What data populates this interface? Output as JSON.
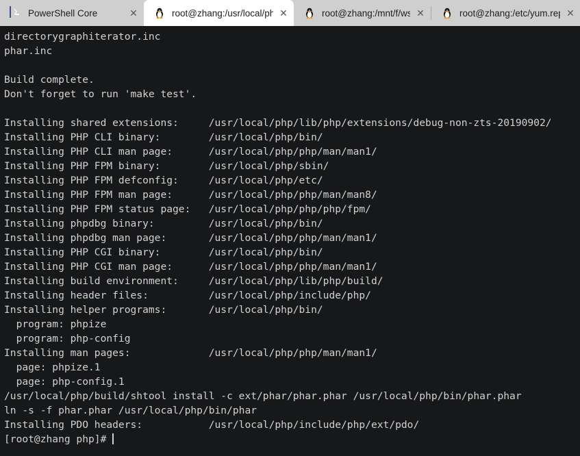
{
  "window": {
    "tabbar_bg": "#cfcfcf",
    "active_tab_bg": "#ffffff",
    "terminal_bg": "#17181a",
    "terminal_fg": "#d2d2d2"
  },
  "tabs": [
    {
      "label": "PowerShell Core",
      "icon": "powershell-icon",
      "active": false,
      "close_label": "✕"
    },
    {
      "label": "root@zhang:/usr/local/ph",
      "icon": "linux-tux-icon",
      "active": true,
      "close_label": "✕"
    },
    {
      "label": "root@zhang:/mnt/f/wsl",
      "icon": "linux-tux-icon",
      "active": false,
      "close_label": "✕"
    },
    {
      "label": "root@zhang:/etc/yum.rep",
      "icon": "linux-tux-icon",
      "active": false,
      "close_label": "✕"
    }
  ],
  "terminal": {
    "lines": [
      "directorygraphiterator.inc",
      "phar.inc",
      "",
      "Build complete.",
      "Don't forget to run 'make test'.",
      "",
      "Installing shared extensions:     /usr/local/php/lib/php/extensions/debug-non-zts-20190902/",
      "Installing PHP CLI binary:        /usr/local/php/bin/",
      "Installing PHP CLI man page:      /usr/local/php/php/man/man1/",
      "Installing PHP FPM binary:        /usr/local/php/sbin/",
      "Installing PHP FPM defconfig:     /usr/local/php/etc/",
      "Installing PHP FPM man page:      /usr/local/php/php/man/man8/",
      "Installing PHP FPM status page:   /usr/local/php/php/php/fpm/",
      "Installing phpdbg binary:         /usr/local/php/bin/",
      "Installing phpdbg man page:       /usr/local/php/php/man/man1/",
      "Installing PHP CGI binary:        /usr/local/php/bin/",
      "Installing PHP CGI man page:      /usr/local/php/php/man/man1/",
      "Installing build environment:     /usr/local/php/lib/php/build/",
      "Installing header files:          /usr/local/php/include/php/",
      "Installing helper programs:       /usr/local/php/bin/",
      "  program: phpize",
      "  program: php-config",
      "Installing man pages:             /usr/local/php/php/man/man1/",
      "  page: phpize.1",
      "  page: php-config.1",
      "/usr/local/php/build/shtool install -c ext/phar/phar.phar /usr/local/php/bin/phar.phar",
      "ln -s -f phar.phar /usr/local/php/bin/phar",
      "Installing PDO headers:           /usr/local/php/include/php/ext/pdo/"
    ],
    "prompt": "[root@zhang php]# ",
    "cursor_visible": true
  }
}
